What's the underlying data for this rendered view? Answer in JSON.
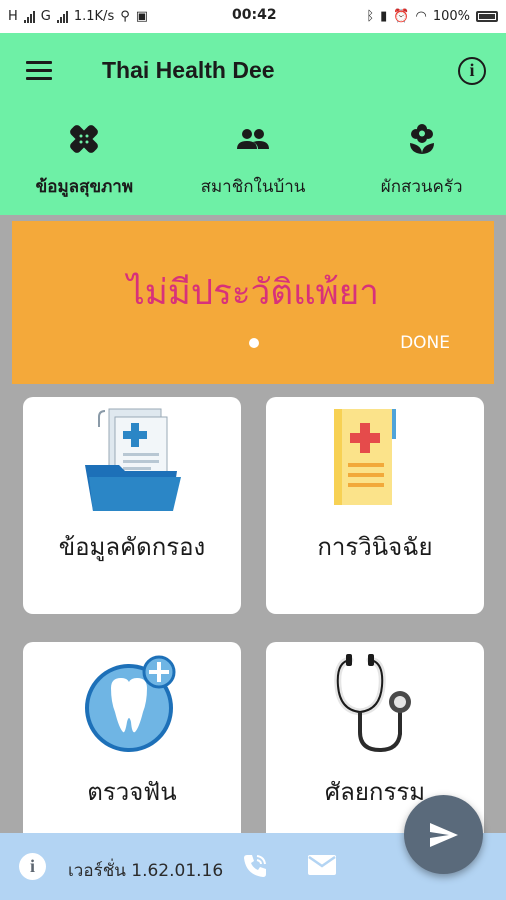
{
  "status_bar": {
    "net1": "H",
    "net2": "G",
    "speed": "1.1K/s",
    "time": "00:42",
    "battery_pct": "100%"
  },
  "app_bar": {
    "title": "Thai Health Dee",
    "tabs": [
      {
        "label": "ข้อมูลสุขภาพ",
        "icon": "bandage-icon",
        "active": true
      },
      {
        "label": "สมาชิกในบ้าน",
        "icon": "people-icon",
        "active": false
      },
      {
        "label": "ผักสวนครัว",
        "icon": "flower-icon",
        "active": false
      }
    ]
  },
  "banner": {
    "text": "ไม่มีประวัติแพ้ยา",
    "done_label": "DONE"
  },
  "cards": [
    {
      "label": "ข้อมูลคัดกรอง",
      "icon": "medical-folder-icon"
    },
    {
      "label": "การวินิจฉัย",
      "icon": "medical-report-icon"
    },
    {
      "label": "ตรวจฟัน",
      "icon": "tooth-icon"
    },
    {
      "label": "ศัลยกรรม",
      "icon": "stethoscope-icon"
    }
  ],
  "footer": {
    "version": "เวอร์ชั่น 1.62.01.16"
  },
  "colors": {
    "app_bar": "#6ef0a6",
    "banner": "#f4a93a",
    "banner_text": "#d8317a",
    "footer": "#b3d4f3",
    "fab": "#5a6a7b"
  }
}
